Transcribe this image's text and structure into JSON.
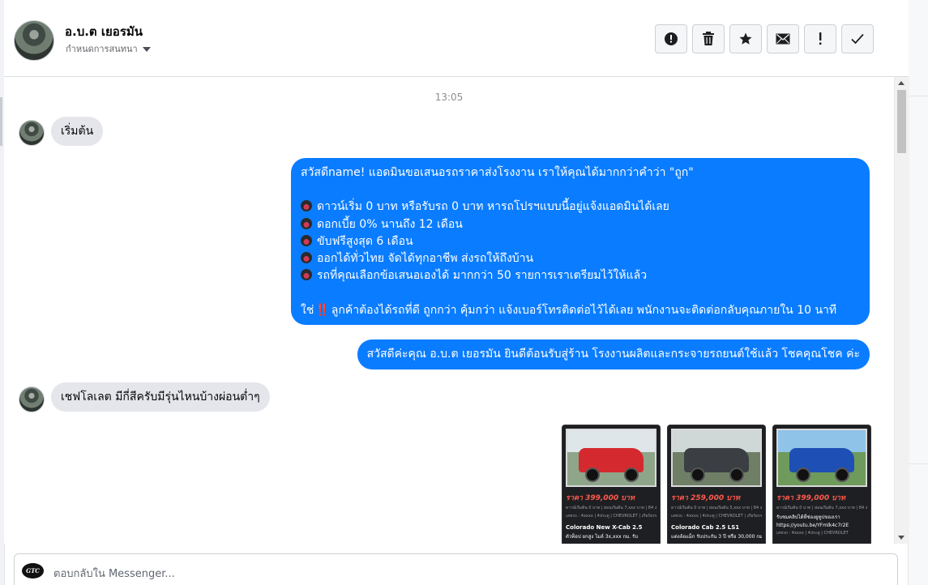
{
  "header": {
    "contact_name": "อ.บ.ต เยอรมัน",
    "subtitle": "กำหนดการสนทนา",
    "actions": [
      {
        "name": "report",
        "icon": "exclamation-circle-icon"
      },
      {
        "name": "delete",
        "icon": "trash-icon"
      },
      {
        "name": "star",
        "icon": "star-icon"
      },
      {
        "name": "mark-unread",
        "icon": "envelope-icon"
      },
      {
        "name": "spam",
        "icon": "exclamation-icon"
      },
      {
        "name": "done",
        "icon": "check-icon"
      }
    ]
  },
  "thread": {
    "timestamp": "13:05",
    "msg1": "เริ่มต้น",
    "out1": {
      "greeting": "สวัสดีname! แอดมินขอเสนอรถราคาส่งโรงงาน เราให้คุณได้มากกว่าคำว่า \"ถูก\"",
      "bullets": [
        "ดาวน์เริ่ม 0 บาท หรือรับรถ 0 บาท หารถโปรฯแบบนี้อยู่แจ้งแอดมินได้เลย",
        "ดอกเบี้ย 0% นานถึง 12 เดือน",
        "ขับฟรีสูงสุด 6 เดือน",
        "ออกได้ทั่วไทย จัดได้ทุกอาชีพ ส่งรถให้ถึงบ้าน",
        "รถที่คุณเลือกข้อเสนอเองได้ มากกว่า 50 รายการเราเตรียมไว้ให้แล้ว"
      ],
      "closing_prefix": "ใช่",
      "closing_mark": "‼️",
      "closing_rest": "ลูกค้าต้องได้รถที่ดี ถูกกว่า คุ้มกว่า แจ้งเบอร์โทรติดต่อไว้ได้เลย พนักงานจะติดต่อกลับคุณภายใน 10 นาที"
    },
    "out2": "สวัสดีค่ะคุณ อ.บ.ต เยอรมัน ยินดีต้อนรับสู่ร้าน โรงงานผลิตและกระจายรถยนต์ใช้แล้ว โชคคุณโชค ค่ะ",
    "msg2": "เชฟโลเลต มีกี่สีครับมีรุ่นไหนบ้างผ่อนต่ำๆ",
    "cards": [
      {
        "price": "ราคา 399,000 บาท",
        "details": "ดาวน์เริ่มต้น 0 บาท | ผ่อนเริ่มต้น 7,xxx บาท | 84 งวด",
        "tags": "เลขรถ : 4xxxx | 4ประตู | CHEVROLET | เกียร์ธรรมดา",
        "model": "Colorado New X-Cab 2.5",
        "sub": "ตัวท็อป ยกสูง ไมล์ 3x,xxx กม. รับ",
        "car_color": "#d42a2f",
        "sky": "#dfe6ea",
        "ground": "#8fa58a"
      },
      {
        "price": "ราคา 259,000 บาท",
        "details": "ดาวน์เริ่มต้น 0 บาท | ผ่อนเริ่มต้น 5,xxx บาท | 84 งวด",
        "tags": "เลขรถ : 4xxxx | 4ประตู | CHEVROLET | เกียร์ธรรมดา",
        "model": "Colorado Cab 2.5 LS1",
        "sub": "แต่งล้อแม็ก รับประกัน 3 ปี หรือ 30,000 กม.",
        "car_color": "#3b3f44",
        "sky": "#cfd8d6",
        "ground": "#6f7f66"
      },
      {
        "price": "ราคา 399,000 บาท",
        "details": "ดาวน์เริ่มต้น 0 บาท | ผ่อนเริ่มต้น 7,xxx บาท | 84 งวด",
        "tags": "รับชมคลิปได้ที่ช่องยูทูปของเรา",
        "model": "https://youtu.be/YFmlk4c7r2E",
        "sub": "เลขรถ : 4xxxx | 4ประตู | CHEVROLET",
        "car_color": "#1d4fb5",
        "sky": "#8fc3e8",
        "ground": "#6e9a5b"
      }
    ]
  },
  "composer": {
    "placeholder": "ตอบกลับใน Messenger...",
    "page_avatar_text": "GTC"
  }
}
